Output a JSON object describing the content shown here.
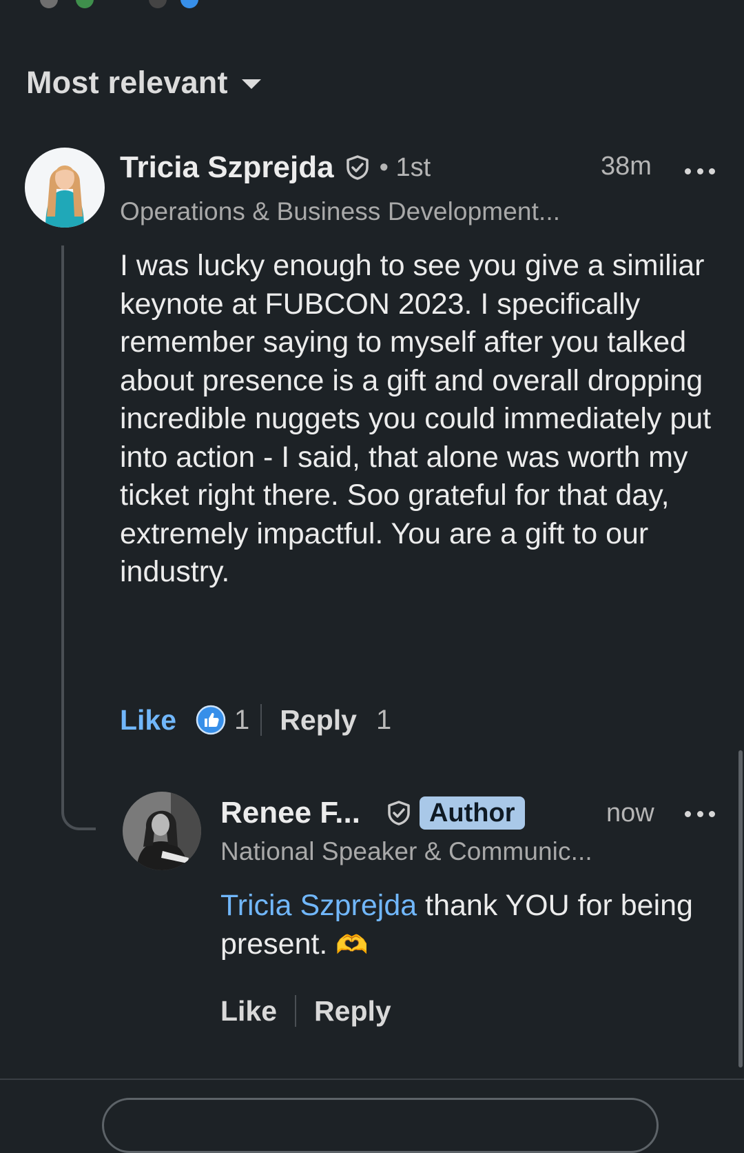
{
  "sort": {
    "label": "Most relevant"
  },
  "comment": {
    "author_name": "Tricia Szprejda",
    "degree": "• 1st",
    "timestamp": "38m",
    "headline": "Operations & Business Development...",
    "text": "I was lucky enough to see you give a similiar keynote at FUBCON 2023. I specifically remember saying to myself after you talked about presence is a gift and overall dropping incredible nuggets you could immediately put into action - I said, that alone was worth my ticket right there. Soo grateful for that day, extremely impactful. You are a gift to our industry.",
    "like_label": "Like",
    "reaction_count": "1",
    "reply_label": "Reply",
    "reply_count": "1"
  },
  "reply": {
    "author_name": "Renee F...",
    "badge": "Author",
    "timestamp": "now",
    "headline": "National Speaker & Communic...",
    "mention": "Tricia Szprejda",
    "text_after_mention": " thank YOU for being present. ",
    "emoji": "🫶",
    "like_label": "Like",
    "reply_label": "Reply"
  },
  "icons": {
    "sort_caret": "caret-down-icon",
    "verified": "shield-check-icon",
    "more": "ellipsis-icon",
    "reaction": "thumbs-up-reaction-icon"
  },
  "colors": {
    "background": "#1d2226",
    "link_blue": "#71b7fb",
    "author_badge": "#a9c8e8",
    "reaction_blue": "#378fe9"
  }
}
